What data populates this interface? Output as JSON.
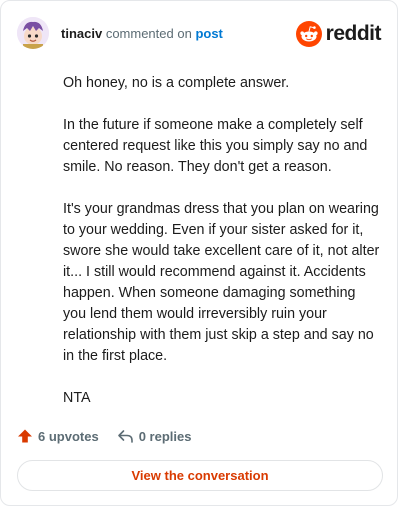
{
  "header": {
    "username": "tinaciv",
    "commented_on": "commented on",
    "post_link": "post",
    "brand": "reddit"
  },
  "comment": {
    "paragraphs": [
      "Oh honey, no is a complete answer.",
      "In the future if someone make a completely self centered request like this you simply say no and smile. No reason. They don't get a reason.",
      "It's your grandmas dress that you plan on wearing to your wedding. Even if your sister asked for it, swore she would take excellent care of it, not alter it... I still would recommend against it. Accidents happen. When someone damaging something you lend them would irreversibly ruin your relationship with them just skip a step and say no in the first place.",
      "NTA"
    ]
  },
  "actions": {
    "upvotes": "6 upvotes",
    "replies": "0 replies"
  },
  "view_button": "View the conversation",
  "colors": {
    "brand_orange": "#ff4500",
    "link_blue": "#0079d3",
    "button_text": "#d93a00"
  }
}
